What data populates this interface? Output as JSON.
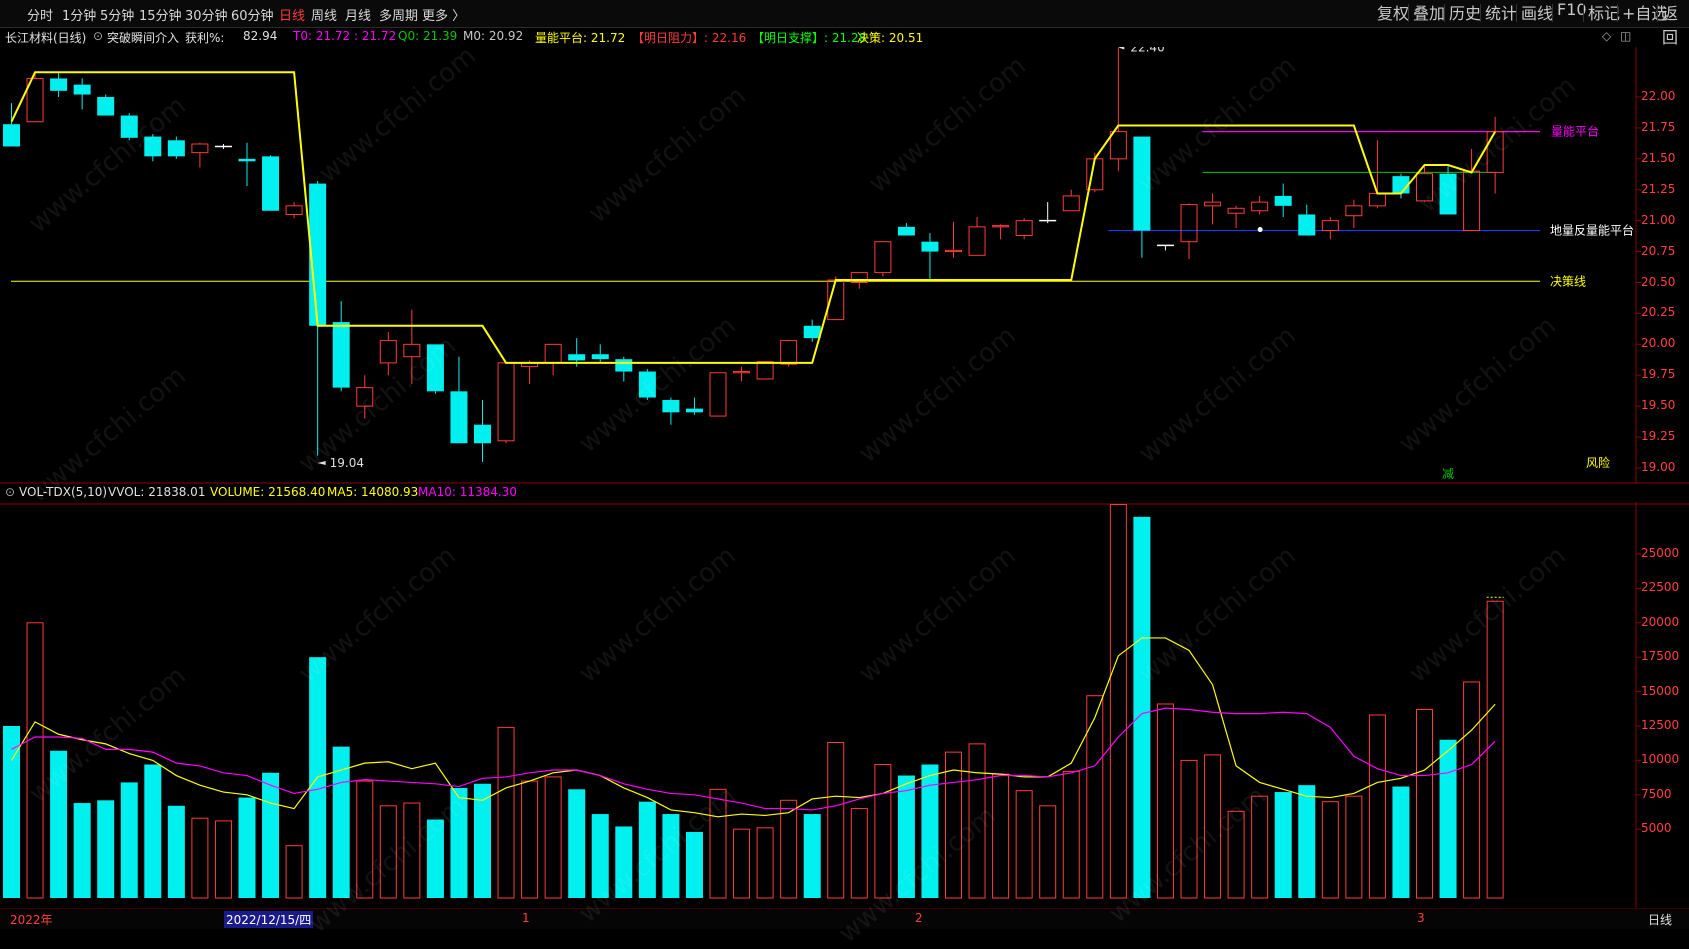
{
  "toolbar": {
    "timeframes": [
      "分时",
      "1分钟",
      "5分钟",
      "15分钟",
      "30分钟",
      "60分钟",
      "日线",
      "周线",
      "月线",
      "多周期",
      "更多 〉"
    ],
    "active_timeframe": "日线",
    "right_buttons": [
      "复权",
      "叠加",
      "历史",
      "统计",
      "画线",
      "F10",
      "标记",
      "+自选",
      "返回"
    ]
  },
  "info": {
    "stock": "长江材料(日线)",
    "indicator": "突破瞬间介入",
    "profit_label": "获利%:",
    "profit_value": "82.94",
    "t0": "T0: 21.72 : 21.72",
    "q0": "Q0: 21.39",
    "m0": "M0: 20.92",
    "platform": "量能平台: 21.72",
    "resist": "【明日阻力】: 22.16",
    "support": "【明日支撑】: 21.28",
    "decision": "决策: 20.51"
  },
  "chart_labels": {
    "high": "22.40",
    "low": "19.04",
    "platform": "量能平台",
    "ground": "地量反量能平台",
    "decision": "决策线",
    "risk": "风险",
    "reduce": "减"
  },
  "colors": {
    "up": "#ff3b3b",
    "down": "#00f0f0",
    "yellow": "#ffff00",
    "magenta": "#ff00ff",
    "green": "#00c800",
    "blue": "#1a3cff",
    "axis": "#ff4040"
  },
  "price_axis": [
    "22.00",
    "21.75",
    "21.50",
    "21.25",
    "21.00",
    "20.75",
    "20.50",
    "20.25",
    "20.00",
    "19.75",
    "19.50",
    "19.25",
    "19.00"
  ],
  "vol_axis": [
    "25000",
    "22500",
    "20000",
    "17500",
    "15000",
    "12500",
    "10000",
    "7500",
    "5000"
  ],
  "vol_info": {
    "name": "VOL-TDX(5,10)",
    "vvol": "VVOL: 21838.01",
    "volume": "VOLUME: 21568.40",
    "ma5": "MA5: 14080.93",
    "ma10": "MA10: 11384.30"
  },
  "bottom": {
    "year": "2022年",
    "date": "2022/12/15/四",
    "m1": "1",
    "m2": "2",
    "m3": "3",
    "period": "日线"
  },
  "watermark": "www.cfchi.com",
  "chart_data": {
    "type": "candlestick",
    "ylim": [
      19.0,
      22.4
    ],
    "vol_ylim": [
      0,
      28000
    ],
    "ohlc": [
      [
        21.78,
        21.95,
        21.6,
        21.6
      ],
      [
        21.8,
        22.2,
        21.8,
        22.15
      ],
      [
        22.15,
        22.2,
        22.0,
        22.05
      ],
      [
        22.1,
        22.15,
        21.9,
        22.02
      ],
      [
        22.0,
        22.02,
        21.85,
        21.85
      ],
      [
        21.85,
        21.87,
        21.65,
        21.67
      ],
      [
        21.68,
        21.7,
        21.48,
        21.52
      ],
      [
        21.65,
        21.68,
        21.5,
        21.52
      ],
      [
        21.55,
        21.63,
        21.43,
        21.62
      ],
      [
        21.6,
        21.62,
        21.58,
        21.6
      ],
      [
        21.5,
        21.63,
        21.28,
        21.48
      ],
      [
        21.52,
        21.53,
        21.08,
        21.08
      ],
      [
        21.05,
        21.15,
        21.02,
        21.12
      ],
      [
        21.3,
        21.32,
        19.1,
        20.15
      ],
      [
        20.18,
        20.35,
        19.62,
        19.65
      ],
      [
        19.5,
        19.75,
        19.4,
        19.65
      ],
      [
        19.85,
        20.1,
        19.75,
        20.03
      ],
      [
        19.9,
        20.28,
        19.68,
        20.0
      ],
      [
        20.0,
        20.0,
        19.6,
        19.62
      ],
      [
        19.62,
        19.9,
        19.2,
        19.2
      ],
      [
        19.35,
        19.55,
        19.05,
        19.2
      ],
      [
        19.22,
        19.85,
        19.2,
        19.85
      ],
      [
        19.82,
        19.87,
        19.68,
        19.85
      ],
      [
        19.85,
        20.0,
        19.75,
        20.0
      ],
      [
        19.92,
        20.05,
        19.82,
        19.87
      ],
      [
        19.92,
        20.0,
        19.85,
        19.88
      ],
      [
        19.88,
        19.9,
        19.7,
        19.78
      ],
      [
        19.78,
        19.8,
        19.55,
        19.57
      ],
      [
        19.55,
        19.57,
        19.35,
        19.45
      ],
      [
        19.48,
        19.57,
        19.43,
        19.45
      ],
      [
        19.42,
        19.77,
        19.42,
        19.77
      ],
      [
        19.77,
        19.82,
        19.7,
        19.78
      ],
      [
        19.72,
        19.86,
        19.72,
        19.86
      ],
      [
        19.84,
        20.03,
        19.82,
        20.03
      ],
      [
        20.15,
        20.2,
        20.02,
        20.05
      ],
      [
        20.2,
        20.55,
        20.2,
        20.52
      ],
      [
        20.5,
        20.58,
        20.45,
        20.58
      ],
      [
        20.58,
        20.83,
        20.55,
        20.83
      ],
      [
        20.95,
        20.98,
        20.88,
        20.88
      ],
      [
        20.83,
        20.9,
        20.52,
        20.75
      ],
      [
        20.75,
        20.99,
        20.7,
        20.76
      ],
      [
        20.72,
        21.03,
        20.72,
        20.95
      ],
      [
        20.95,
        20.97,
        20.85,
        20.96
      ],
      [
        20.88,
        21.02,
        20.85,
        21.0
      ],
      [
        21.0,
        21.15,
        20.98,
        21.0
      ],
      [
        21.08,
        21.25,
        21.08,
        21.2
      ],
      [
        21.25,
        21.55,
        21.23,
        21.5
      ],
      [
        21.5,
        22.4,
        21.4,
        21.72
      ],
      [
        21.68,
        21.68,
        20.7,
        20.92
      ],
      [
        20.8,
        20.8,
        20.76,
        20.8
      ],
      [
        20.83,
        21.14,
        20.69,
        21.13
      ],
      [
        21.12,
        21.22,
        20.97,
        21.15
      ],
      [
        21.06,
        21.12,
        20.94,
        21.1
      ],
      [
        21.08,
        21.2,
        21.05,
        21.15
      ],
      [
        21.2,
        21.3,
        21.03,
        21.12
      ],
      [
        21.05,
        21.13,
        20.88,
        20.88
      ],
      [
        20.92,
        21.03,
        20.85,
        21.0
      ],
      [
        21.04,
        21.17,
        20.94,
        21.12
      ],
      [
        21.12,
        21.65,
        21.1,
        21.22
      ],
      [
        21.36,
        21.38,
        21.18,
        21.22
      ],
      [
        21.16,
        21.45,
        21.15,
        21.38
      ],
      [
        21.38,
        21.45,
        21.05,
        21.05
      ],
      [
        20.92,
        21.58,
        20.92,
        21.4
      ],
      [
        21.39,
        21.84,
        21.22,
        21.72
      ]
    ],
    "volume": [
      12500,
      20000,
      10700,
      6900,
      7100,
      8400,
      9700,
      6700,
      5800,
      5600,
      7300,
      9100,
      3800,
      17500,
      11000,
      8500,
      6700,
      6900,
      5700,
      8000,
      8300,
      12400,
      8500,
      8800,
      7900,
      6100,
      5200,
      7000,
      6100,
      4800,
      7900,
      5000,
      5100,
      7100,
      6100,
      11300,
      6500,
      9700,
      8900,
      9700,
      10600,
      11200,
      9000,
      7800,
      6700,
      9200,
      14700,
      28600,
      27700,
      14100,
      10000,
      10400,
      6300,
      7400,
      7700,
      8200,
      7000,
      7400,
      13300,
      8100,
      13700,
      11500,
      15700,
      21568
    ],
    "ma5": [
      10000,
      12800,
      11900,
      11500,
      11200,
      10500,
      10000,
      8900,
      8200,
      7700,
      7500,
      6900,
      6500,
      8800,
      9300,
      9800,
      9900,
      9400,
      9800,
      7300,
      7100,
      8000,
      8500,
      9100,
      9300,
      8900,
      8000,
      7300,
      6400,
      6200,
      5900,
      6100,
      6000,
      6200,
      7200,
      7400,
      7300,
      7600,
      8300,
      8900,
      9300,
      9100,
      9000,
      8800,
      8800,
      9800,
      13100,
      17600,
      18900,
      18900,
      18000,
      15500,
      9600,
      8400,
      7900,
      7400,
      7300,
      7600,
      8400,
      8700,
      9300,
      10700,
      12200,
      14080
    ],
    "ma10": [
      10800,
      11700,
      11700,
      11600,
      10800,
      10800,
      10600,
      9800,
      9600,
      9100,
      8900,
      8200,
      7600,
      7900,
      8400,
      8600,
      8500,
      8400,
      8300,
      8100,
      8700,
      8800,
      9100,
      9300,
      9300,
      8900,
      8300,
      7900,
      7600,
      7500,
      7200,
      6900,
      6500,
      6500,
      6400,
      6700,
      7200,
      7600,
      7800,
      8200,
      8400,
      8600,
      8900,
      8900,
      8800,
      9100,
      9600,
      11700,
      13400,
      13800,
      13700,
      13500,
      13400,
      13400,
      13500,
      13400,
      12400,
      10300,
      9400,
      8900,
      8900,
      9100,
      9700,
      11384
    ],
    "platform_line": [
      21.8,
      22.2,
      22.2,
      22.2,
      22.2,
      22.2,
      22.2,
      22.2,
      22.2,
      22.2,
      22.2,
      22.2,
      22.2,
      20.15,
      20.15,
      20.15,
      20.15,
      20.15,
      20.15,
      20.15,
      20.15,
      19.85,
      19.85,
      19.85,
      19.85,
      19.85,
      19.85,
      19.85,
      19.85,
      19.85,
      19.85,
      19.85,
      19.85,
      19.85,
      19.85,
      20.52,
      20.52,
      20.52,
      20.52,
      20.52,
      20.52,
      20.52,
      20.52,
      20.52,
      20.52,
      20.52,
      21.5,
      21.77,
      21.77,
      21.77,
      21.77,
      21.77,
      21.77,
      21.77,
      21.77,
      21.77,
      21.77,
      21.77,
      21.22,
      21.22,
      21.45,
      21.45,
      21.39,
      21.72
    ],
    "decision_line": 20.51,
    "platform_level": 21.72,
    "support_level": 21.39,
    "ground_level": 20.92
  }
}
